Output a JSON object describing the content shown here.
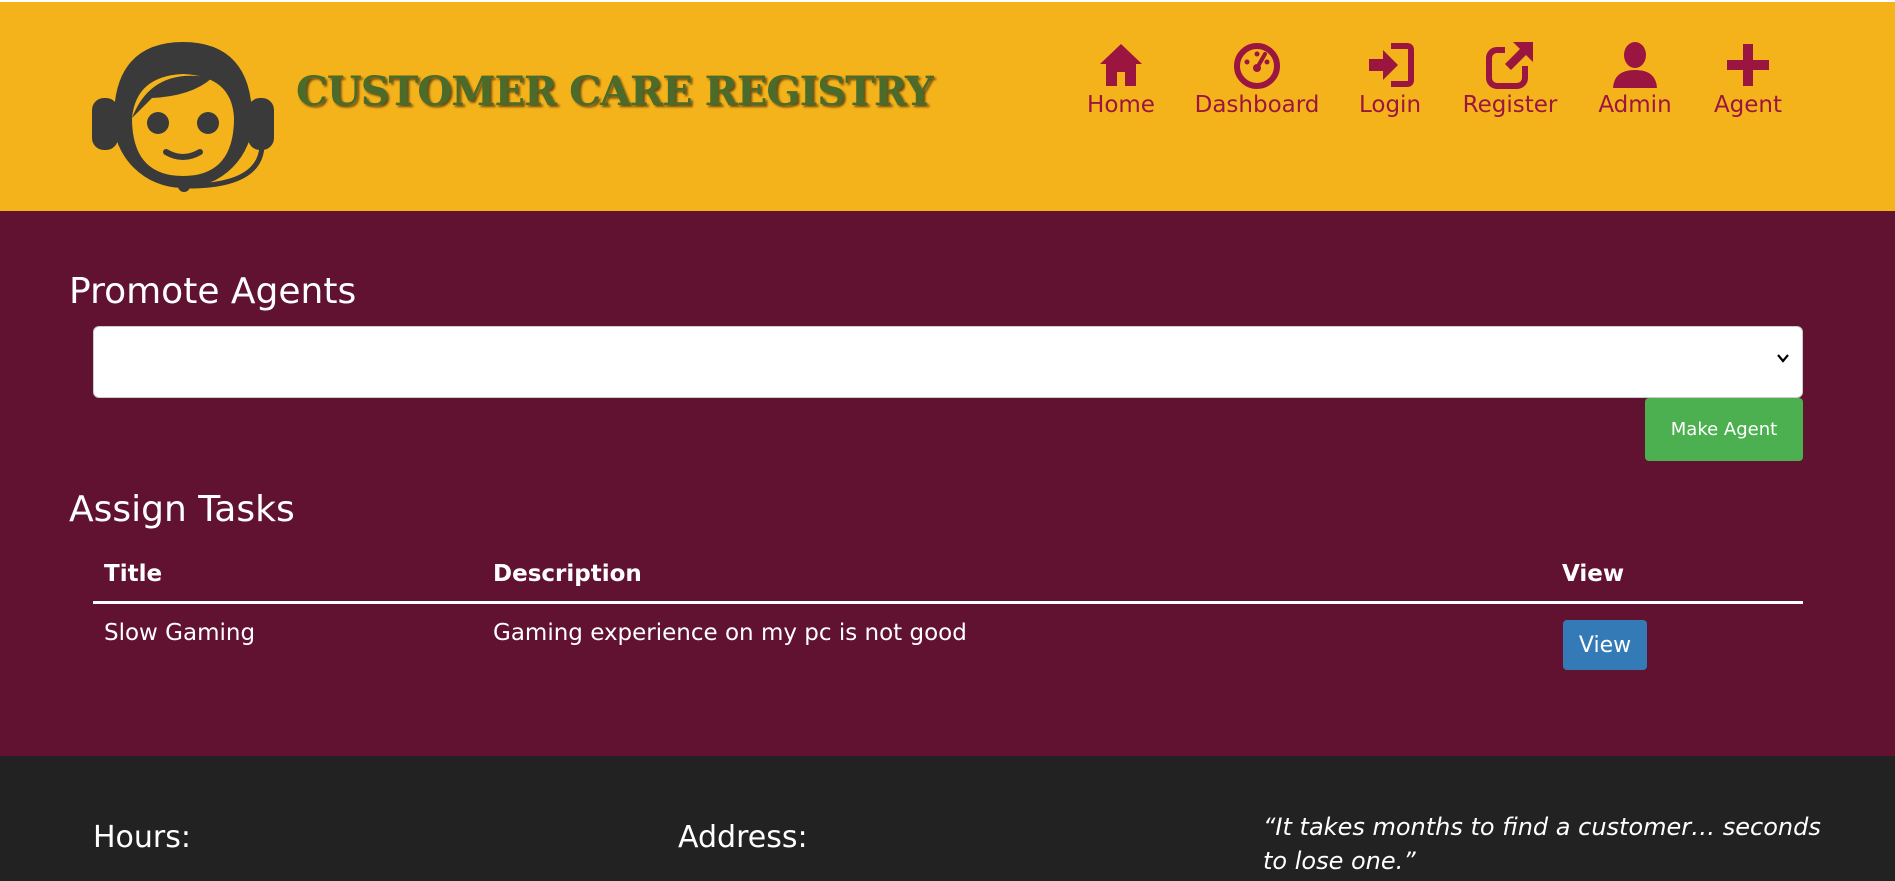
{
  "header": {
    "brand": "CUSTOMER CARE REGISTRY",
    "logo_icon": "headset-support-icon",
    "nav": [
      {
        "label": "Home",
        "icon": "home-icon"
      },
      {
        "label": "Dashboard",
        "icon": "dashboard-gauge-icon"
      },
      {
        "label": "Login",
        "icon": "login-icon"
      },
      {
        "label": "Register",
        "icon": "external-link-icon"
      },
      {
        "label": "Admin",
        "icon": "user-icon"
      },
      {
        "label": "Agent",
        "icon": "plus-icon"
      }
    ]
  },
  "promote": {
    "title": "Promote Agents",
    "select_value": "",
    "button_label": "Make Agent"
  },
  "assign": {
    "title": "Assign Tasks",
    "columns": [
      "Title",
      "Description",
      "View"
    ],
    "rows": [
      {
        "title": "Slow Gaming",
        "description": "Gaming experience on my pc is not good",
        "action": "View"
      }
    ]
  },
  "footer": {
    "hours_label": "Hours:",
    "address_label": "Address:",
    "quote": "“It takes months to find a customer… seconds to lose one.”"
  },
  "colors": {
    "header_bg": "#f5b31b",
    "main_bg": "#611230",
    "nav_color": "#9a1540",
    "make_agent_button": "#4caf50",
    "view_button": "#337ab7",
    "footer_bg": "#222222"
  }
}
